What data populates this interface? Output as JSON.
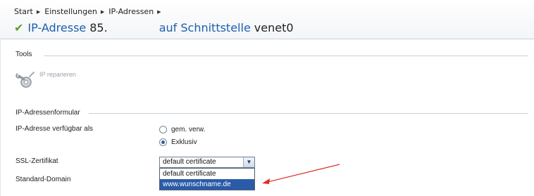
{
  "breadcrumb": [
    "Start",
    "Einstellungen",
    "IP-Adressen"
  ],
  "title": {
    "prefix": "IP-Adresse",
    "ip": "85.",
    "on_label": "auf Schnittstelle",
    "interface": "venet0"
  },
  "tools": {
    "section_title": "Tools",
    "repair_label": "IP reparieren"
  },
  "form": {
    "section_title": "IP-Adressenformular",
    "availability_label": "IP-Adresse verfügbar als",
    "options": [
      "gem. verw.",
      "Exklusiv"
    ],
    "selected_option": "Exklusiv",
    "ssl_label": "SSL-Zertifikat",
    "ssl_value": "default certificate",
    "ssl_dropdown_options": [
      "default certificate",
      "www.wunschname.de"
    ],
    "domain_label": "Standard-Domain"
  },
  "colors": {
    "accent": "#1d5fae",
    "check": "#5aa02c",
    "highlight": "#2a5ba8",
    "annotation_arrow": "#d9312b"
  }
}
